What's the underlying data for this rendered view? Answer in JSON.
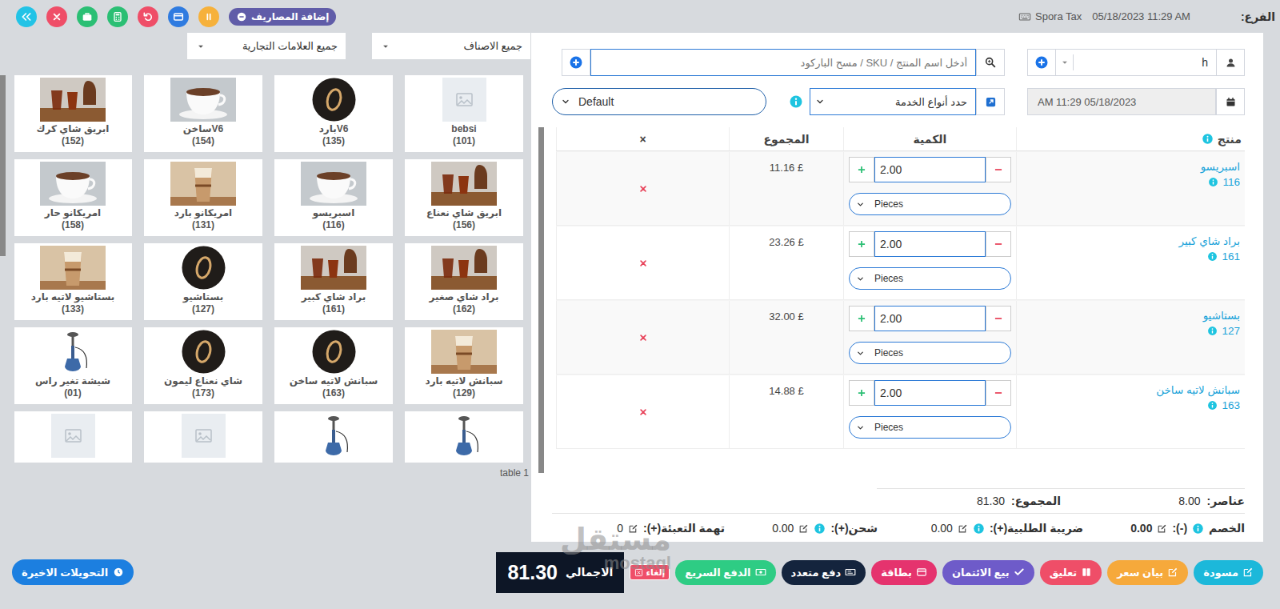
{
  "header": {
    "branch_label": "الفرع:",
    "datetime": "05/18/2023 11:29 AM",
    "store": "Spora Tax",
    "tools": [
      {
        "kind": "back",
        "color": "#22c3e6"
      },
      {
        "kind": "close",
        "color": "#ef4e68"
      },
      {
        "kind": "briefcase",
        "color": "#2bbf74"
      },
      {
        "kind": "calculator",
        "color": "#2bbf74"
      },
      {
        "kind": "undo",
        "color": "#ef4e68"
      },
      {
        "kind": "window",
        "color": "#2f7be0"
      },
      {
        "kind": "pause",
        "color": "#f6b13b"
      }
    ],
    "expenses_button": "إضافة المصاريف"
  },
  "customer": {
    "value": "h"
  },
  "product_search": {
    "placeholder": "أدخل اسم المنتج / SKU / مسح الباركود"
  },
  "transaction_date": {
    "value": "AM 11:29 05/18/2023"
  },
  "service_type": {
    "placeholder": "حدد أنواع الخدمة"
  },
  "price_group": {
    "value": "Default"
  },
  "cart": {
    "columns": [
      "منتج",
      "الكمية",
      "المجموع",
      "×"
    ],
    "rows": [
      {
        "name": "اسبريسو",
        "code": "116",
        "qty": "2.00",
        "unit": "Pieces",
        "total": "11.16 £"
      },
      {
        "name": "براد شاي كبير",
        "code": "161",
        "qty": "2.00",
        "unit": "Pieces",
        "total": "23.26 £"
      },
      {
        "name": "بستاشيو",
        "code": "127",
        "qty": "2.00",
        "unit": "Pieces",
        "total": "32.00 £"
      },
      {
        "name": "سبانش لاتيه ساخن",
        "code": "163",
        "qty": "2.00",
        "unit": "Pieces",
        "total": "14.88 £"
      }
    ]
  },
  "summary": {
    "items_label": "عناصر:",
    "items": "8.00",
    "subtotal_label": "المجموع:",
    "subtotal": "81.30",
    "charges": [
      {
        "kind": "discount",
        "label": "الخصم",
        "sign": "(-):",
        "value": "0.00"
      },
      {
        "kind": "info",
        "label": "ضريبة الطلبية(+):",
        "value": "0.00"
      },
      {
        "kind": "info",
        "label": "شحن(+):",
        "value": "0.00"
      },
      {
        "kind": "plain",
        "label": "تهمة التعبئة(+):",
        "value": "0"
      }
    ]
  },
  "products": {
    "filters": [
      "جميع الاصناف",
      "جميع العلامات التجارية"
    ],
    "items": [
      {
        "name": "bebsi",
        "code": "(101)",
        "kind": "placeholder"
      },
      {
        "name": "V6بارد",
        "code": "(135)",
        "kind": "logo"
      },
      {
        "name": "V6ساخن",
        "code": "(154)",
        "kind": "coffee"
      },
      {
        "name": "ابريق شاي كرك",
        "code": "(152)",
        "kind": "tea"
      },
      {
        "name": "ابريق شاي نعناع",
        "code": "(156)",
        "kind": "tea"
      },
      {
        "name": "اسبريسو",
        "code": "(116)",
        "kind": "coffee"
      },
      {
        "name": "امريكانو بارد",
        "code": "(131)",
        "kind": "iced"
      },
      {
        "name": "امريكانو حار",
        "code": "(158)",
        "kind": "coffee"
      },
      {
        "name": "براد شاي صغير",
        "code": "(162)",
        "kind": "tea"
      },
      {
        "name": "براد شاي كبير",
        "code": "(161)",
        "kind": "tea"
      },
      {
        "name": "بستاشيو",
        "code": "(127)",
        "kind": "logo"
      },
      {
        "name": "بستاشيو لاتيه بارد",
        "code": "(133)",
        "kind": "iced"
      },
      {
        "name": "سبانش لاتيه بارد",
        "code": "(129)",
        "kind": "iced"
      },
      {
        "name": "سبانش لاتيه ساخن",
        "code": "(163)",
        "kind": "logo"
      },
      {
        "name": "شاي نعناع ليمون",
        "code": "(173)",
        "kind": "logo"
      },
      {
        "name": "شيشة تغير راس",
        "code": "(01)",
        "kind": "hookah"
      },
      {
        "kind": "hookah"
      },
      {
        "kind": "hookah"
      },
      {
        "kind": "placeholder"
      },
      {
        "kind": "placeholder"
      }
    ],
    "table_label": "table 1"
  },
  "footer": {
    "recent": "التحويلات الاخيرة",
    "actions": [
      {
        "label": "مسودة",
        "kind": "edit",
        "color": "#1cb8da"
      },
      {
        "label": "بيان سعر",
        "kind": "edit",
        "color": "#f6a93b"
      },
      {
        "label": "تعليق",
        "kind": "columns",
        "color": "#ef4e68"
      },
      {
        "label": "بيع الائتمان",
        "kind": "check",
        "color": "#6e5bc9"
      },
      {
        "label": "بطاقة",
        "kind": "card",
        "color": "#e5336e"
      },
      {
        "label": "دفع متعدد",
        "kind": "money",
        "color": "#14243d"
      },
      {
        "label": "الدفع السريع",
        "kind": "cash",
        "color": "#2ecc84"
      }
    ],
    "cancel": "إلغاء",
    "total_label": "الاجمالي",
    "total": "81.30"
  },
  "watermark": {
    "arabic": "مستقل",
    "latin": "mostaql"
  }
}
